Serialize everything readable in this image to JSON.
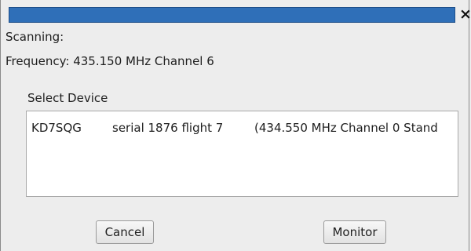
{
  "window": {
    "close_glyph": "×"
  },
  "status": {
    "scanning_label": "Scanning:",
    "frequency_text": "Frequency: 435.150 MHz Channel 6"
  },
  "device_select": {
    "label": "Select Device",
    "items": [
      {
        "callsign": "KD7SQG",
        "serial": "serial 1876 flight 7",
        "info": "(434.550 MHz Channel 0 Stand"
      }
    ]
  },
  "buttons": {
    "cancel_label": "Cancel",
    "monitor_label": "Monitor"
  },
  "colors": {
    "titlebar": "#2f6fb8",
    "background": "#ededed",
    "list_background": "#ffffff"
  }
}
